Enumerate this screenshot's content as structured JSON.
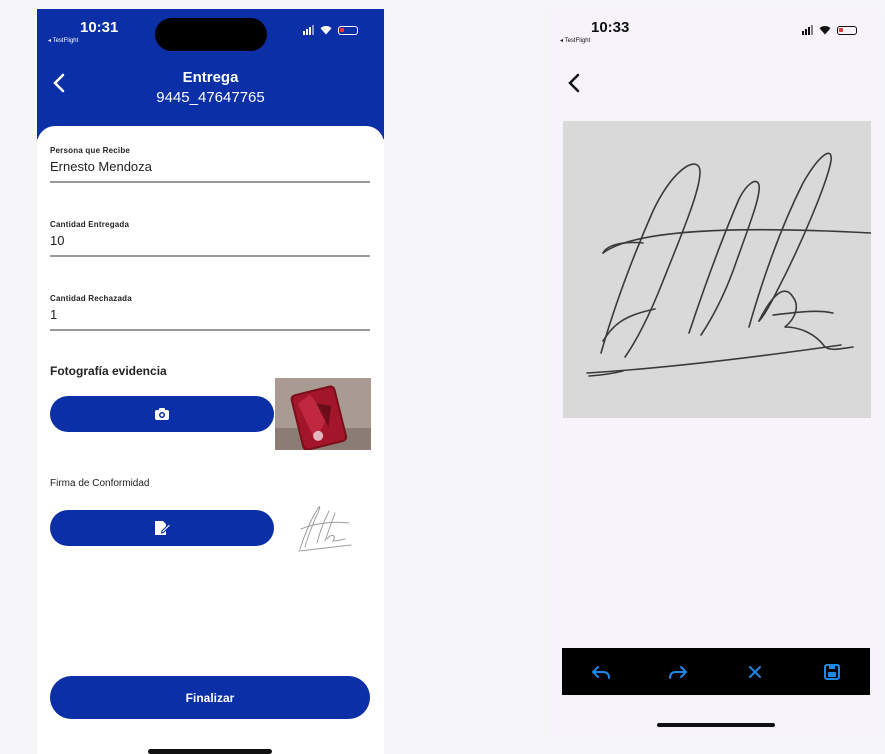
{
  "left": {
    "status": {
      "time": "10:31",
      "back_app": "◂ TestFlight"
    },
    "header": {
      "title": "Entrega",
      "subtitle": "9445_47647765",
      "back_icon": "chevron-left-icon"
    },
    "fields": [
      {
        "label": "Persona que Recibe",
        "value": "Ernesto Mendoza"
      },
      {
        "label": "Cantidad Entregada",
        "value": "10"
      },
      {
        "label": "Cantidad Rechazada",
        "value": "1"
      }
    ],
    "photo_section": {
      "title": "Fotografía evidencia",
      "button_icon": "camera-icon"
    },
    "signature_section": {
      "title": "Firma de Conformidad",
      "button_icon": "signature-icon"
    },
    "finalize_label": "Finalizar"
  },
  "right": {
    "status": {
      "time": "10:33",
      "back_app": "◂ TestFlight"
    },
    "toolbar": [
      "undo-icon",
      "redo-icon",
      "clear-icon",
      "save-icon"
    ]
  },
  "colors": {
    "primary": "#0b2fa6",
    "canvas": "#d9d9d9",
    "toolbar": "#000000",
    "tool_icon": "#1e88e5"
  }
}
